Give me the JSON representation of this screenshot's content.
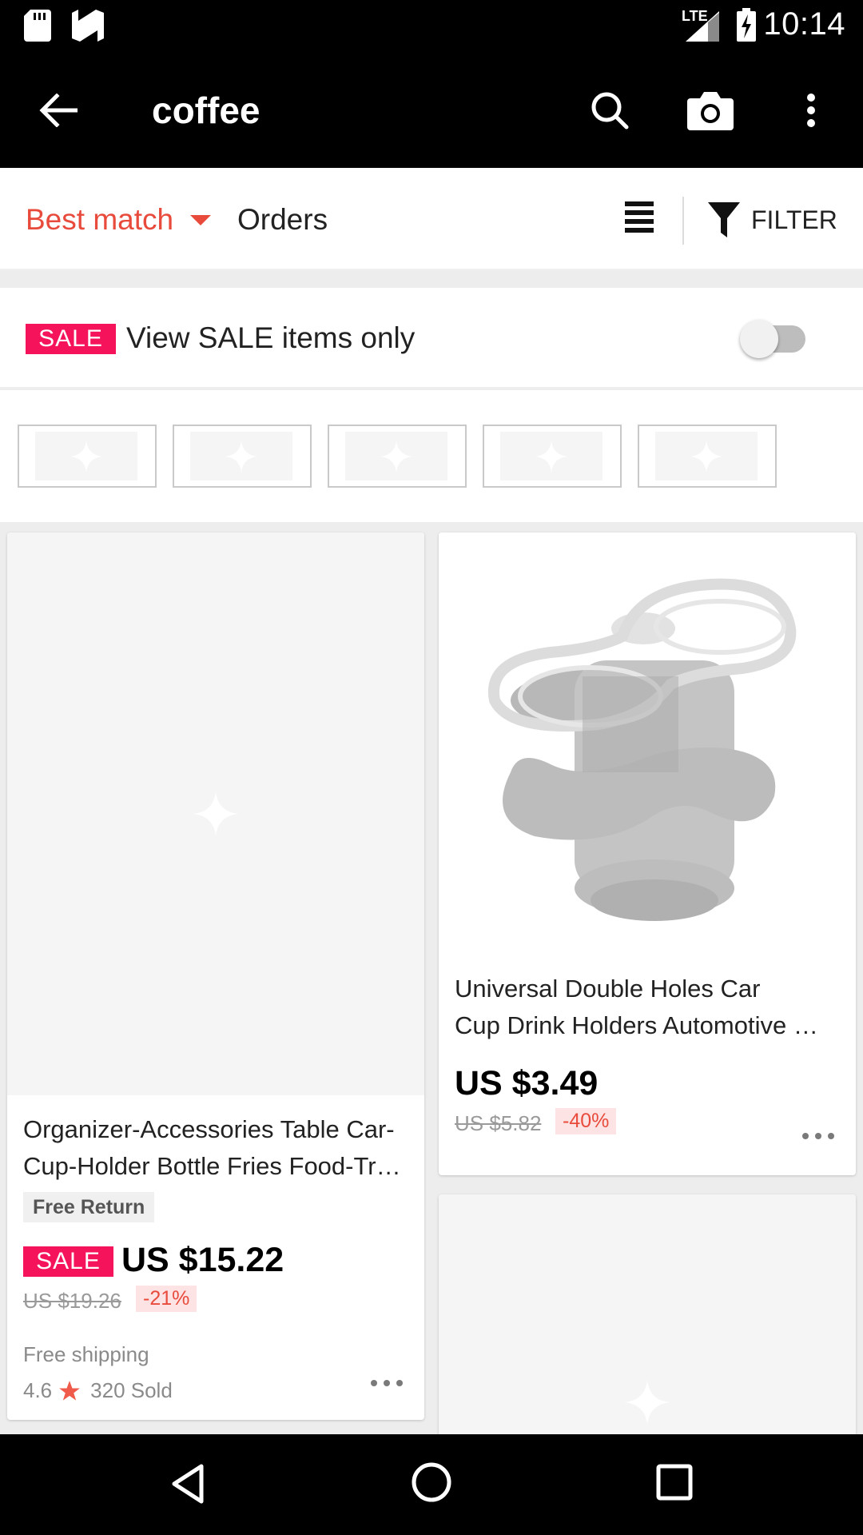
{
  "status_bar": {
    "time": "10:14",
    "network": "LTE"
  },
  "app_bar": {
    "title": "coffee"
  },
  "sort": {
    "best_match": "Best match",
    "orders": "Orders",
    "filter": "FILTER"
  },
  "sale_toggle": {
    "badge": "SALE",
    "label": "View SALE items only",
    "enabled": false
  },
  "categories": {
    "count": 5
  },
  "products": [
    {
      "title_line1": "Organizer-Accessories Table Car-",
      "title_line2": "Cup-Holder Bottle Fries Food-Tr…",
      "tag": "Free Return",
      "sale_badge": "SALE",
      "price": "US $15.22",
      "old_price": "US $19.26",
      "discount": "-21%",
      "shipping": "Free shipping",
      "rating": "4.6",
      "sold": "320 Sold"
    },
    {
      "title_line1": "Universal Double Holes Car",
      "title_line2": "Cup Drink Holders Automotive …",
      "price": "US $3.49",
      "old_price": "US $5.82",
      "discount": "-40%"
    }
  ],
  "colors": {
    "accent": "#e84b3c",
    "sale": "#f5135c",
    "bar": "#000000"
  }
}
